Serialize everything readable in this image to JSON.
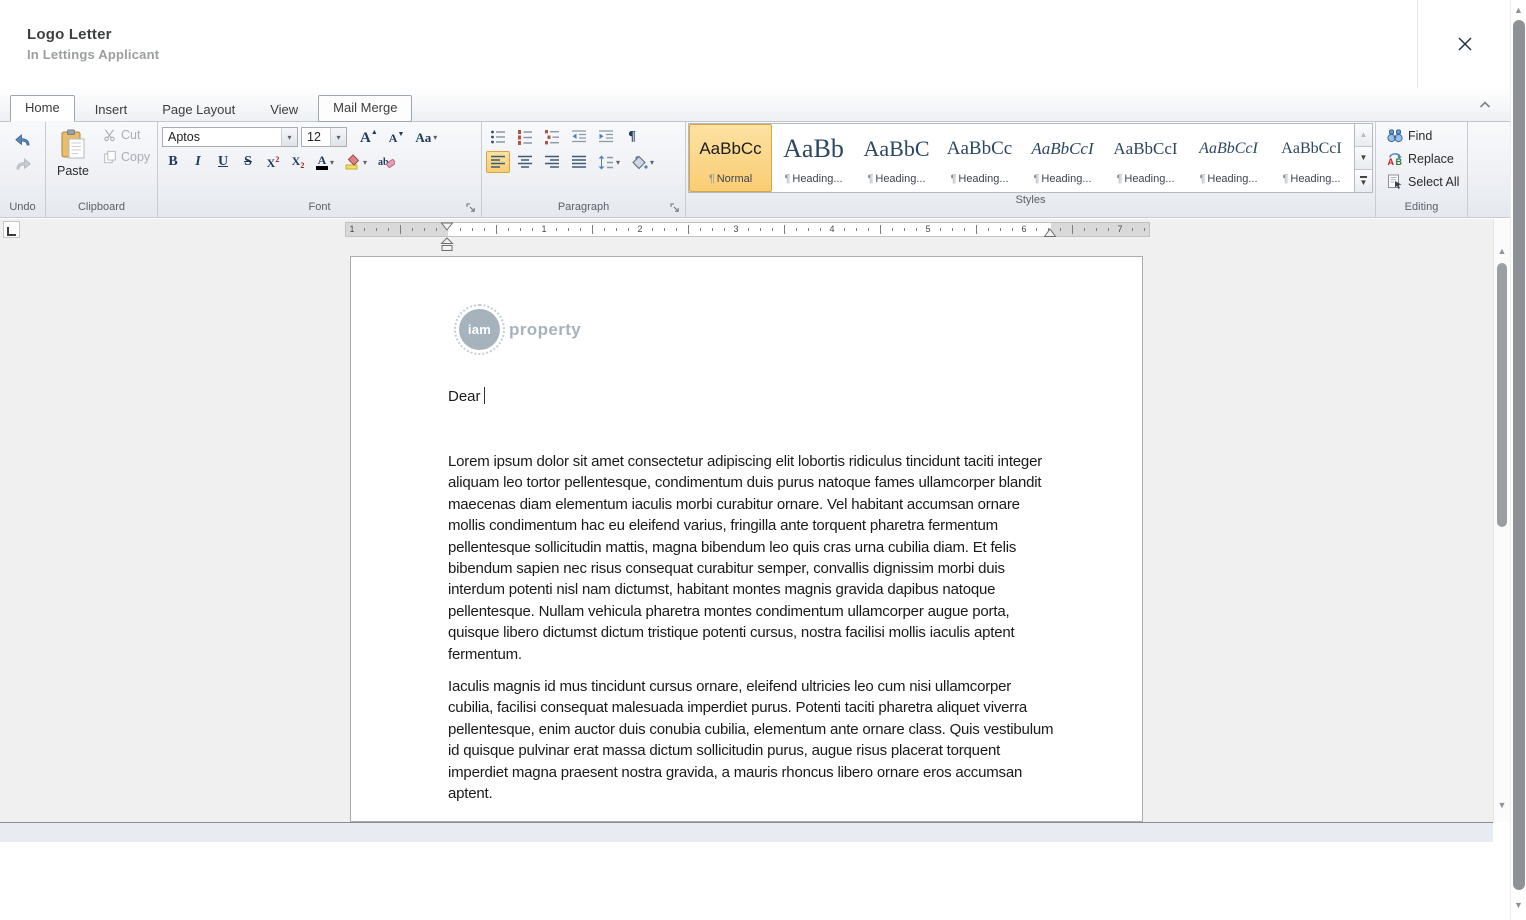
{
  "window": {
    "title": "Logo Letter",
    "subtitle": "In Lettings Applicant"
  },
  "tabs": [
    {
      "label": "Home",
      "state": "active"
    },
    {
      "label": "Insert",
      "state": "normal"
    },
    {
      "label": "Page Layout",
      "state": "normal"
    },
    {
      "label": "View",
      "state": "normal"
    },
    {
      "label": "Mail Merge",
      "state": "outlined"
    }
  ],
  "ribbon": {
    "undo": {
      "label": "Undo"
    },
    "clipboard": {
      "label": "Clipboard",
      "paste": "Paste",
      "cut": "Cut",
      "copy": "Copy"
    },
    "font": {
      "label": "Font",
      "family": "Aptos",
      "size": "12",
      "bold": "B",
      "italic": "I",
      "underline": "U",
      "strikethrough": "S",
      "superscript_base": "X",
      "superscript_mark": "2",
      "subscript_base": "X",
      "subscript_mark": "2",
      "font_color_letter": "A",
      "change_case": "Aa"
    },
    "paragraph": {
      "label": "Paragraph",
      "pilcrow": "¶"
    },
    "styles": {
      "label": "Styles",
      "items": [
        {
          "preview": "AaBbCc",
          "label": "Normal",
          "size": 17,
          "serif": false,
          "italic": false,
          "selected": true
        },
        {
          "preview": "AaBb",
          "label": "Heading...",
          "size": 26,
          "serif": true,
          "italic": false,
          "selected": false
        },
        {
          "preview": "AaBbC",
          "label": "Heading...",
          "size": 22,
          "serif": true,
          "italic": false,
          "selected": false
        },
        {
          "preview": "AaBbCc",
          "label": "Heading...",
          "size": 19,
          "serif": true,
          "italic": false,
          "selected": false
        },
        {
          "preview": "AaBbCcI",
          "label": "Heading...",
          "size": 17,
          "serif": true,
          "italic": true,
          "selected": false
        },
        {
          "preview": "AaBbCcI",
          "label": "Heading...",
          "size": 17,
          "serif": true,
          "italic": false,
          "selected": false
        },
        {
          "preview": "AaBbCcI",
          "label": "Heading...",
          "size": 16,
          "serif": true,
          "italic": true,
          "selected": false
        },
        {
          "preview": "AaBbCcI",
          "label": "Heading...",
          "size": 16,
          "serif": true,
          "italic": false,
          "selected": false
        }
      ]
    },
    "editing": {
      "label": "Editing",
      "find": "Find",
      "replace": "Replace",
      "select_all": "Select All"
    }
  },
  "ruler": {
    "tick_numbers": {
      "-8": "1",
      "8": "1",
      "16": "2",
      "24": "3",
      "32": "4",
      "40": "5",
      "48": "6",
      "56": "7"
    }
  },
  "document": {
    "logo": {
      "badge": "iam",
      "wordmark": "property"
    },
    "salutation": "Dear",
    "paragraphs": [
      "Lorem ipsum dolor sit amet consectetur adipiscing elit lobortis ridiculus tincidunt taciti integer aliquam leo tortor pellentesque, condimentum duis purus natoque fames ullamcorper blandit maecenas diam elementum iaculis morbi curabitur ornare. Vel habitant accumsan ornare mollis condimentum hac eu eleifend varius, fringilla ante torquent pharetra fermentum pellentesque sollicitudin mattis, magna bibendum leo quis cras urna cubilia diam. Et felis bibendum sapien nec risus consequat curabitur semper, convallis dignissim morbi duis interdum potenti nisl nam dictumst, habitant montes magnis gravida dapibus natoque pellentesque. Nullam vehicula pharetra montes condimentum ullamcorper augue porta, quisque libero dictumst dictum tristique potenti cursus, nostra facilisi mollis iaculis aptent fermentum.",
      "Iaculis magnis id mus tincidunt cursus ornare, eleifend ultricies leo cum nisi ullamcorper cubilia, facilisi consequat malesuada imperdiet purus. Potenti taciti pharetra aliquet viverra pellentesque, enim auctor duis conubia cubilia, elementum ante ornare class. Quis vestibulum id quisque pulvinar erat massa dictum sollicitudin purus, augue risus placerat torquent imperdiet magna praesent nostra gravida, a mauris rhoncus libero ornare eros accumsan aptent."
    ]
  },
  "colors": {
    "selection_fill": "#f9cd74",
    "selection_border": "#d8a448",
    "heading_preview": "#2c4761",
    "brand_gray": "#a7b3bc"
  }
}
